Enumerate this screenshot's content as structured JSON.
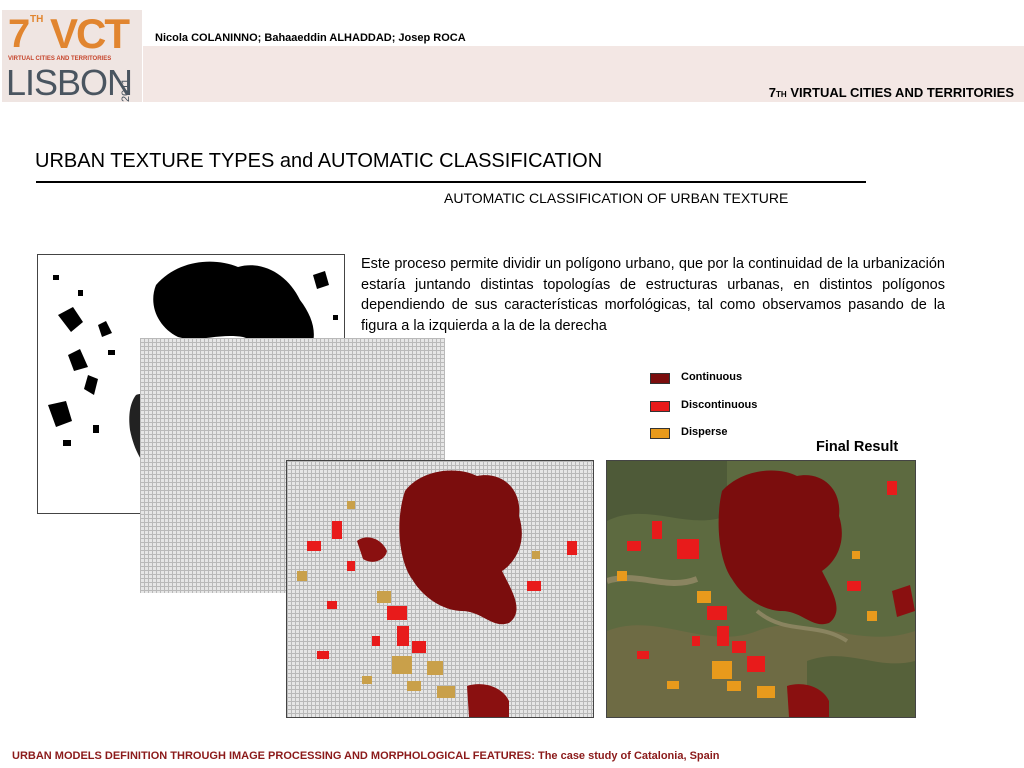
{
  "header": {
    "logo": {
      "number": "7",
      "ordinal": "TH",
      "acronym": "VCT",
      "tagline": "VIRTUAL CITIES AND TERRITORIES",
      "city": "LISBON",
      "year": "2011"
    },
    "authors": "Nicola COLANINNO; Bahaaeddin ALHADDAD; Josep ROCA",
    "conference": {
      "number": "7",
      "ordinal": "TH",
      "name": "VIRTUAL CITIES AND TERRITORIES"
    }
  },
  "main": {
    "title": "URBAN TEXTURE TYPES and AUTOMATIC CLASSIFICATION",
    "subtitle": "AUTOMATIC CLASSIFICATION OF URBAN TEXTURE",
    "body": "Este proceso permite dividir un polígono urbano, que por la continuidad de la urbanización estaría juntando distintas topologías de estructuras urbanas, en distintos polígonos dependiendo de sus características morfológicas, tal como observamos pasando de la figura a la izquierda a la de la derecha",
    "legend": [
      {
        "label": "Continuous",
        "color": "#7b0d0d"
      },
      {
        "label": "Discontinuous",
        "color": "#e81b1b"
      },
      {
        "label": "Disperse",
        "color": "#e89a1c"
      }
    ],
    "final_label": "Final Result"
  },
  "footer": "URBAN MODELS DEFINITION THROUGH IMAGE PROCESSING AND MORPHOLOGICAL FEATURES: The case study of Catalonia, Spain"
}
